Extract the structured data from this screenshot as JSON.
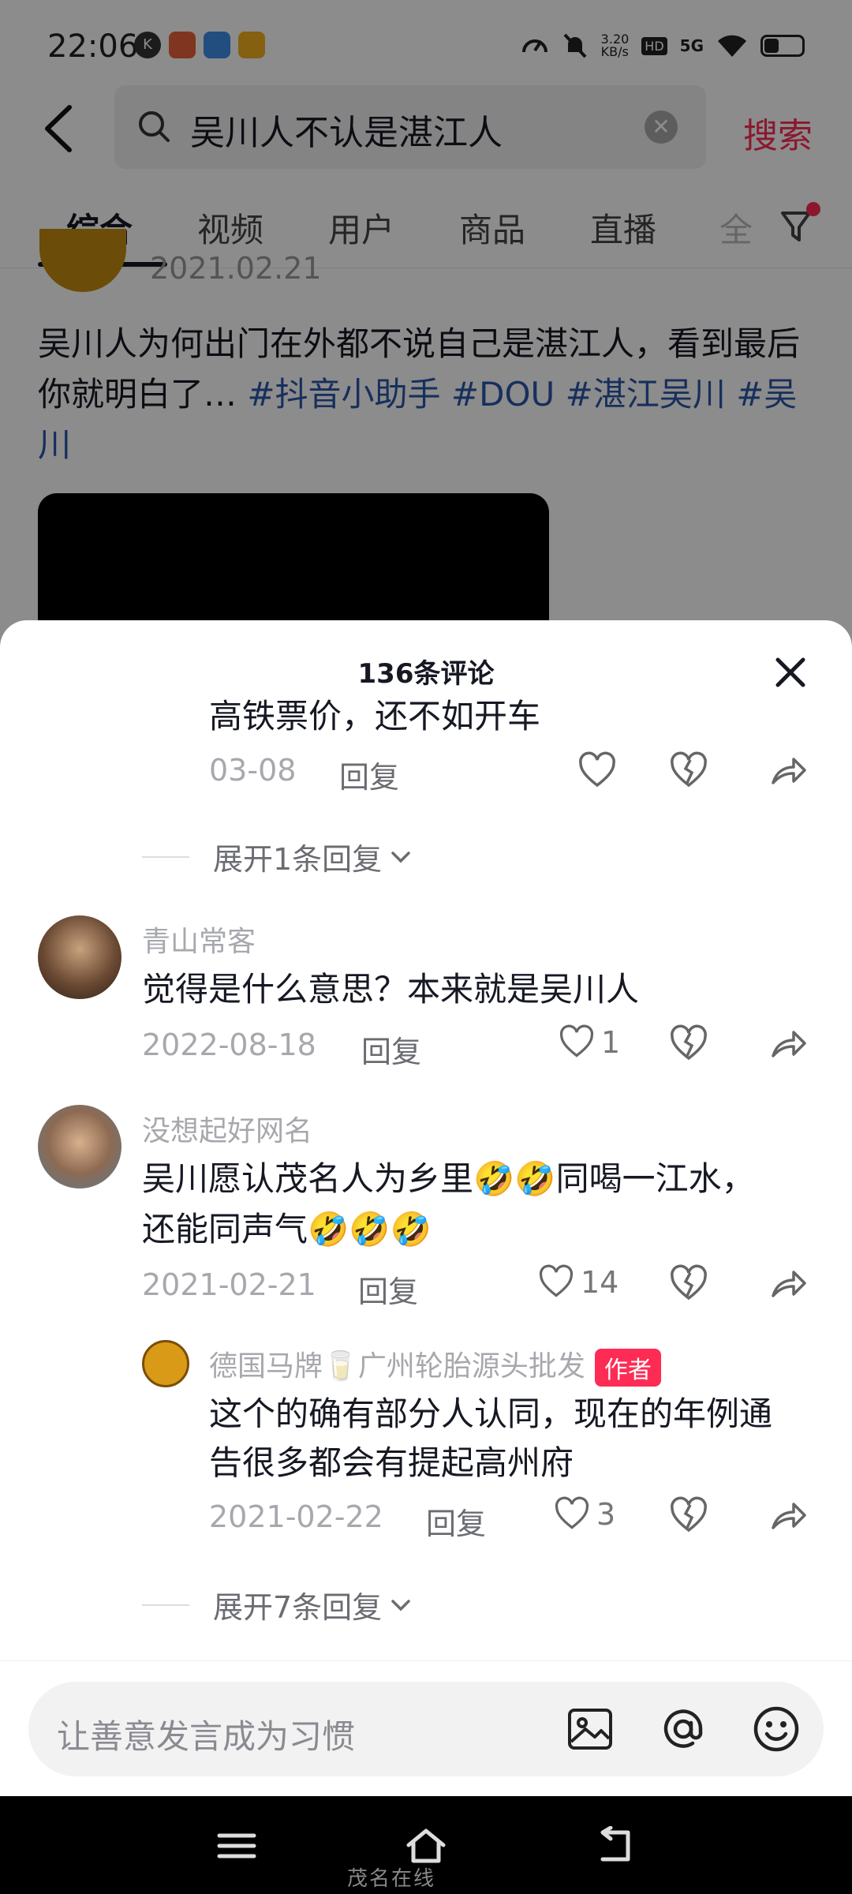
{
  "status_bar": {
    "time": "22:06",
    "network_speed": "3.20\nKB/s",
    "hd_label": "HD",
    "signal_label": "5G"
  },
  "search": {
    "query": "吴川人不认是湛江人",
    "submit_label": "搜索"
  },
  "tabs": [
    {
      "label": "综合",
      "active": true
    },
    {
      "label": "视频"
    },
    {
      "label": "用户"
    },
    {
      "label": "商品"
    },
    {
      "label": "直播"
    },
    {
      "label": "全"
    }
  ],
  "post": {
    "date": "2021.02.21",
    "text_plain": "吴川人为何出门在外都不说自己是湛江人，看到最后你就明白了… ",
    "tags": [
      "#抖音小助手",
      "#DOU",
      "#湛江吴川",
      "#吴川"
    ]
  },
  "comments_sheet": {
    "title": "136条评论",
    "items": [
      {
        "text": "高铁票价，还不如开车",
        "date": "03-08",
        "reply_label": "回复",
        "likes": ""
      },
      {
        "expand_label": "展开1条回复"
      },
      {
        "username": "青山常客",
        "text": "觉得是什么意思？本来就是吴川人",
        "date": "2022-08-18",
        "reply_label": "回复",
        "likes": "1"
      },
      {
        "username": "没想起好网名",
        "text_line1": "吴川愿认茂名人为乡里🤣🤣同喝一江水，",
        "text_line2": "还能同声气🤣🤣🤣",
        "date": "2021-02-21",
        "reply_label": "回复",
        "likes": "14"
      },
      {
        "username": "德国马牌🥛广州轮胎源头批发",
        "author_badge": "作者",
        "text_line1": "这个的确有部分人认同，现在的年例通",
        "text_line2": "告很多都会有提起高州府",
        "date": "2021-02-22",
        "reply_label": "回复",
        "likes": "3"
      },
      {
        "expand_label": "展开7条回复"
      }
    ]
  },
  "input": {
    "placeholder": "让善意发言成为习惯"
  },
  "nav": {
    "watermark": "茂名在线"
  },
  "colors": {
    "accent": "#fe2c55",
    "hashtag": "#2a57a8",
    "muted": "#a7a8ad"
  }
}
